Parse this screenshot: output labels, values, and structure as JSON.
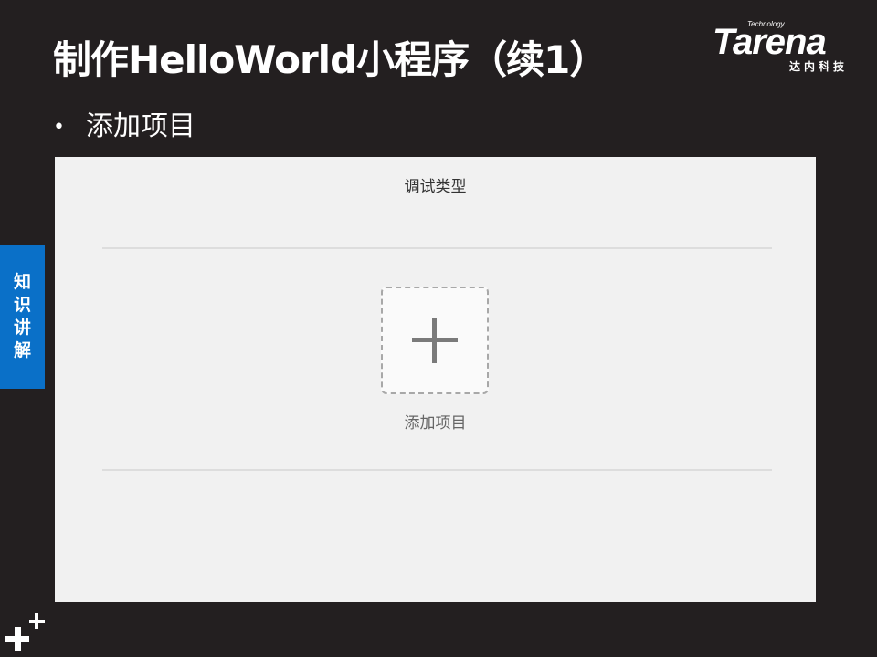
{
  "slide": {
    "title": "制作HelloWorld小程序（续1）",
    "bullet": "添加项目",
    "bullet_marker": "•"
  },
  "logo": {
    "tagline": "Technology",
    "wordmark": "Tarena",
    "subtitle": "达内科技"
  },
  "side_tab": {
    "label": "知识讲解"
  },
  "panel": {
    "title": "调试类型",
    "add_label": "添加项目"
  },
  "icons": {
    "add": "plus-icon",
    "corner": "plus-decoration-icon"
  },
  "colors": {
    "background": "#231f20",
    "side_tab": "#0a70c8",
    "panel": "#f1f1f1",
    "plus": "#7a7a7a"
  }
}
